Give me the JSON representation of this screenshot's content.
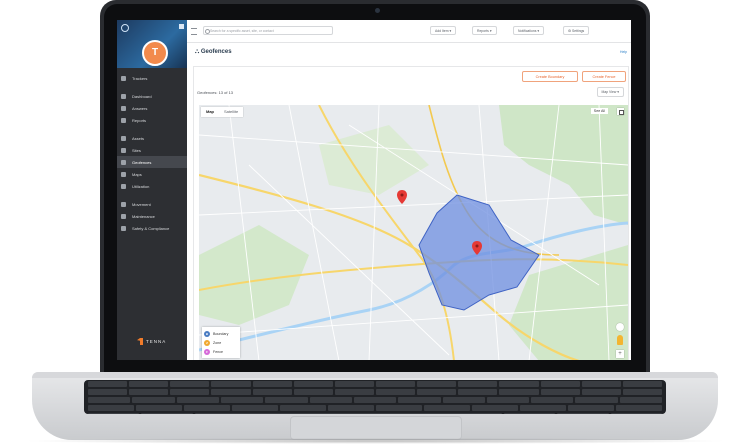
{
  "topbar": {
    "search_placeholder": "Search for a specific asset, site, or contact",
    "add_item": "Add Item",
    "reports": "Reports",
    "notifications": "Notifications",
    "settings": "Settings"
  },
  "sidebar": {
    "avatar_initial": "T",
    "items": [
      {
        "label": "Trackers",
        "icon": "tracker-icon"
      },
      {
        "label": "Dashboard",
        "icon": "dashboard-icon"
      },
      {
        "label": "Answers",
        "icon": "answers-icon"
      },
      {
        "label": "Reports",
        "icon": "reports-icon"
      },
      {
        "label": "Assets",
        "icon": "assets-icon"
      },
      {
        "label": "Sites",
        "icon": "pin-icon"
      },
      {
        "label": "Geofences",
        "icon": "geofence-icon",
        "active": true
      },
      {
        "label": "Maps",
        "icon": "map-icon"
      },
      {
        "label": "Utilization",
        "icon": "chart-icon"
      },
      {
        "label": "Movement",
        "icon": "movement-icon"
      },
      {
        "label": "Maintenance",
        "icon": "wrench-icon"
      },
      {
        "label": "Safety & Compliance",
        "icon": "shield-icon"
      }
    ],
    "brand": "TENNA"
  },
  "page": {
    "title": "Geofences",
    "help": "Help",
    "create_boundary": "Create Boundary",
    "create_fence": "Create Fence",
    "count_label": "Geofences: 13 of 13",
    "map_view": "Map View"
  },
  "map": {
    "tabs": [
      "Map",
      "Satellite"
    ],
    "see_all": "See All",
    "legend": [
      {
        "letter": "B",
        "label": "Boundary",
        "color": "#4a7cc2"
      },
      {
        "letter": "Z",
        "label": "Zone",
        "color": "#f0a830"
      },
      {
        "letter": "F",
        "label": "Fence",
        "color": "#d66ad9"
      }
    ],
    "zoom_in": "+",
    "colors": {
      "polygon_fill": "#6f8fe0",
      "polygon_stroke": "#3f63c4",
      "marker": "#e53935",
      "water": "#a9d3f5",
      "park": "#c9e7c1",
      "highway": "#f7d66b"
    }
  }
}
